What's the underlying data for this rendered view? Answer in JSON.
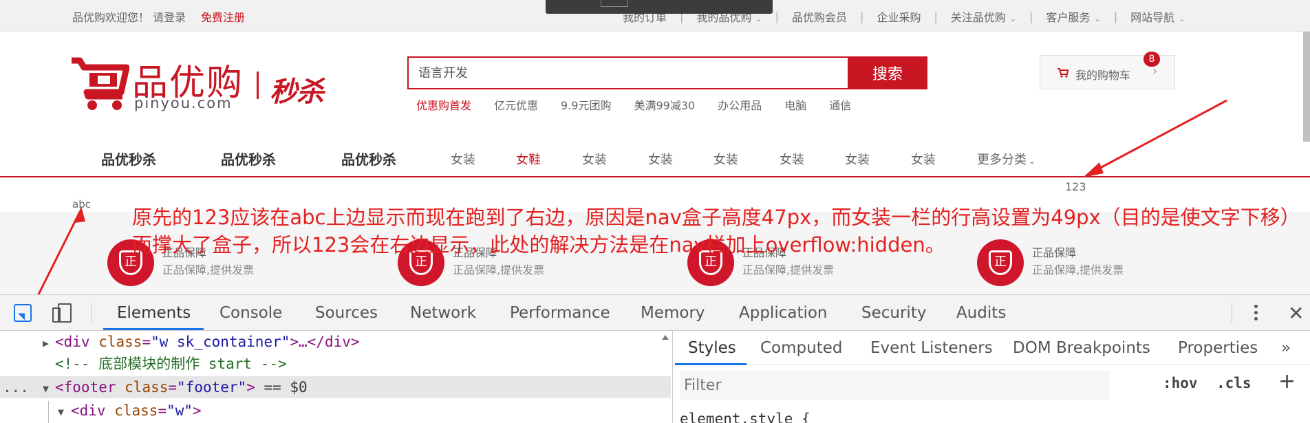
{
  "topbar": {
    "welcome": "品优购欢迎您！ 请登录",
    "register": "免费注册",
    "links": [
      {
        "label": "我的订单",
        "caret": false
      },
      {
        "label": "我的品优购",
        "caret": true
      },
      {
        "label": "品优购会员",
        "caret": false
      },
      {
        "label": "企业采购",
        "caret": false
      },
      {
        "label": "关注品优购",
        "caret": true
      },
      {
        "label": "客户服务",
        "caret": true
      },
      {
        "label": "网站导航",
        "caret": true
      }
    ]
  },
  "logo": {
    "brand_cn": "品优购",
    "brand_en": "pinyou.com",
    "seckill": "秒杀"
  },
  "search": {
    "placeholder": "语言开发",
    "button": "搜索",
    "hotwords": [
      "优惠购首发",
      "亿元优惠",
      "9.9元团购",
      "美满99减30",
      "办公用品",
      "电脑",
      "通信"
    ]
  },
  "shopcar": {
    "label": "我的购物车",
    "count": "8",
    "arrow": "›"
  },
  "nav": {
    "bold_items": [
      "品优秒杀",
      "品优秒杀",
      "品优秒杀"
    ],
    "items": [
      "女装",
      "女鞋",
      "女装",
      "女装",
      "女装",
      "女装",
      "女装",
      "女装"
    ],
    "more": "更多分类"
  },
  "misc": {
    "num": "123",
    "abc": "abc"
  },
  "services": [
    {
      "icon_text": "正",
      "title": "正品保障",
      "desc": "正品保障,提供发票"
    },
    {
      "icon_text": "正",
      "title": "正品保障",
      "desc": "正品保障,提供发票"
    },
    {
      "icon_text": "正",
      "title": "正品保障",
      "desc": "正品保障,提供发票"
    },
    {
      "icon_text": "正",
      "title": "正品保障",
      "desc": "正品保障,提供发票"
    }
  ],
  "annotation": "原先的123应该在abc上边显示而现在跑到了右边，原因是nav盒子高度47px，而女装一栏的行高设置为49px（目的是使文字下移）而撑大了盒子，所以123会在右边显示，此处的解决方法是在nav栏加上overflow:hidden。",
  "devtools": {
    "tabs": [
      "Elements",
      "Console",
      "Sources",
      "Network",
      "Performance",
      "Memory",
      "Application",
      "Security",
      "Audits"
    ],
    "active_tab": "Elements",
    "close": "✕",
    "dom": {
      "line1_tag": "<div ",
      "line1_attr": "class",
      "line1_val": "\"w sk_container\"",
      "line1_rest": ">…</div>",
      "line2_comment": "<!-- 底部模块的制作 start -->",
      "line3_dots": "...",
      "line3_tag": "<footer ",
      "line3_attr": "class",
      "line3_val": "\"footer\"",
      "line3_close": ">",
      "line3_eq": " == $0",
      "line4_tag": "<div ",
      "line4_attr": "class",
      "line4_val": "\"w\"",
      "line4_close": ">"
    },
    "styles_tabs": [
      "Styles",
      "Computed",
      "Event Listeners",
      "DOM Breakpoints",
      "Properties"
    ],
    "styles_more": "»",
    "filter_placeholder": "Filter",
    "hov": ":hov",
    "cls": ".cls",
    "plus": "+",
    "element_style": "element.style {"
  },
  "colors": {
    "brand_red": "#c81623",
    "annotation_red": "#e32121",
    "devtools_blue": "#1a73e8"
  }
}
